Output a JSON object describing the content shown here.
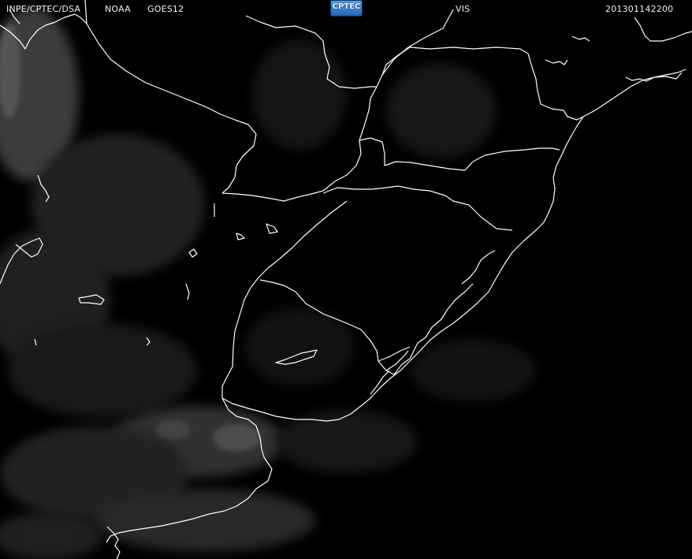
{
  "header": {
    "source": "INPE/CPTEC/DSA",
    "agency": "NOAA",
    "satellite": "GOES12",
    "logo_text": "CPTEC",
    "channel": "VIS",
    "timestamp": "201301142200"
  },
  "colors": {
    "background": "#000000",
    "boundary": "#ffffff",
    "cloud": "#8a8a8a",
    "header_text": "#f2f2f2"
  }
}
